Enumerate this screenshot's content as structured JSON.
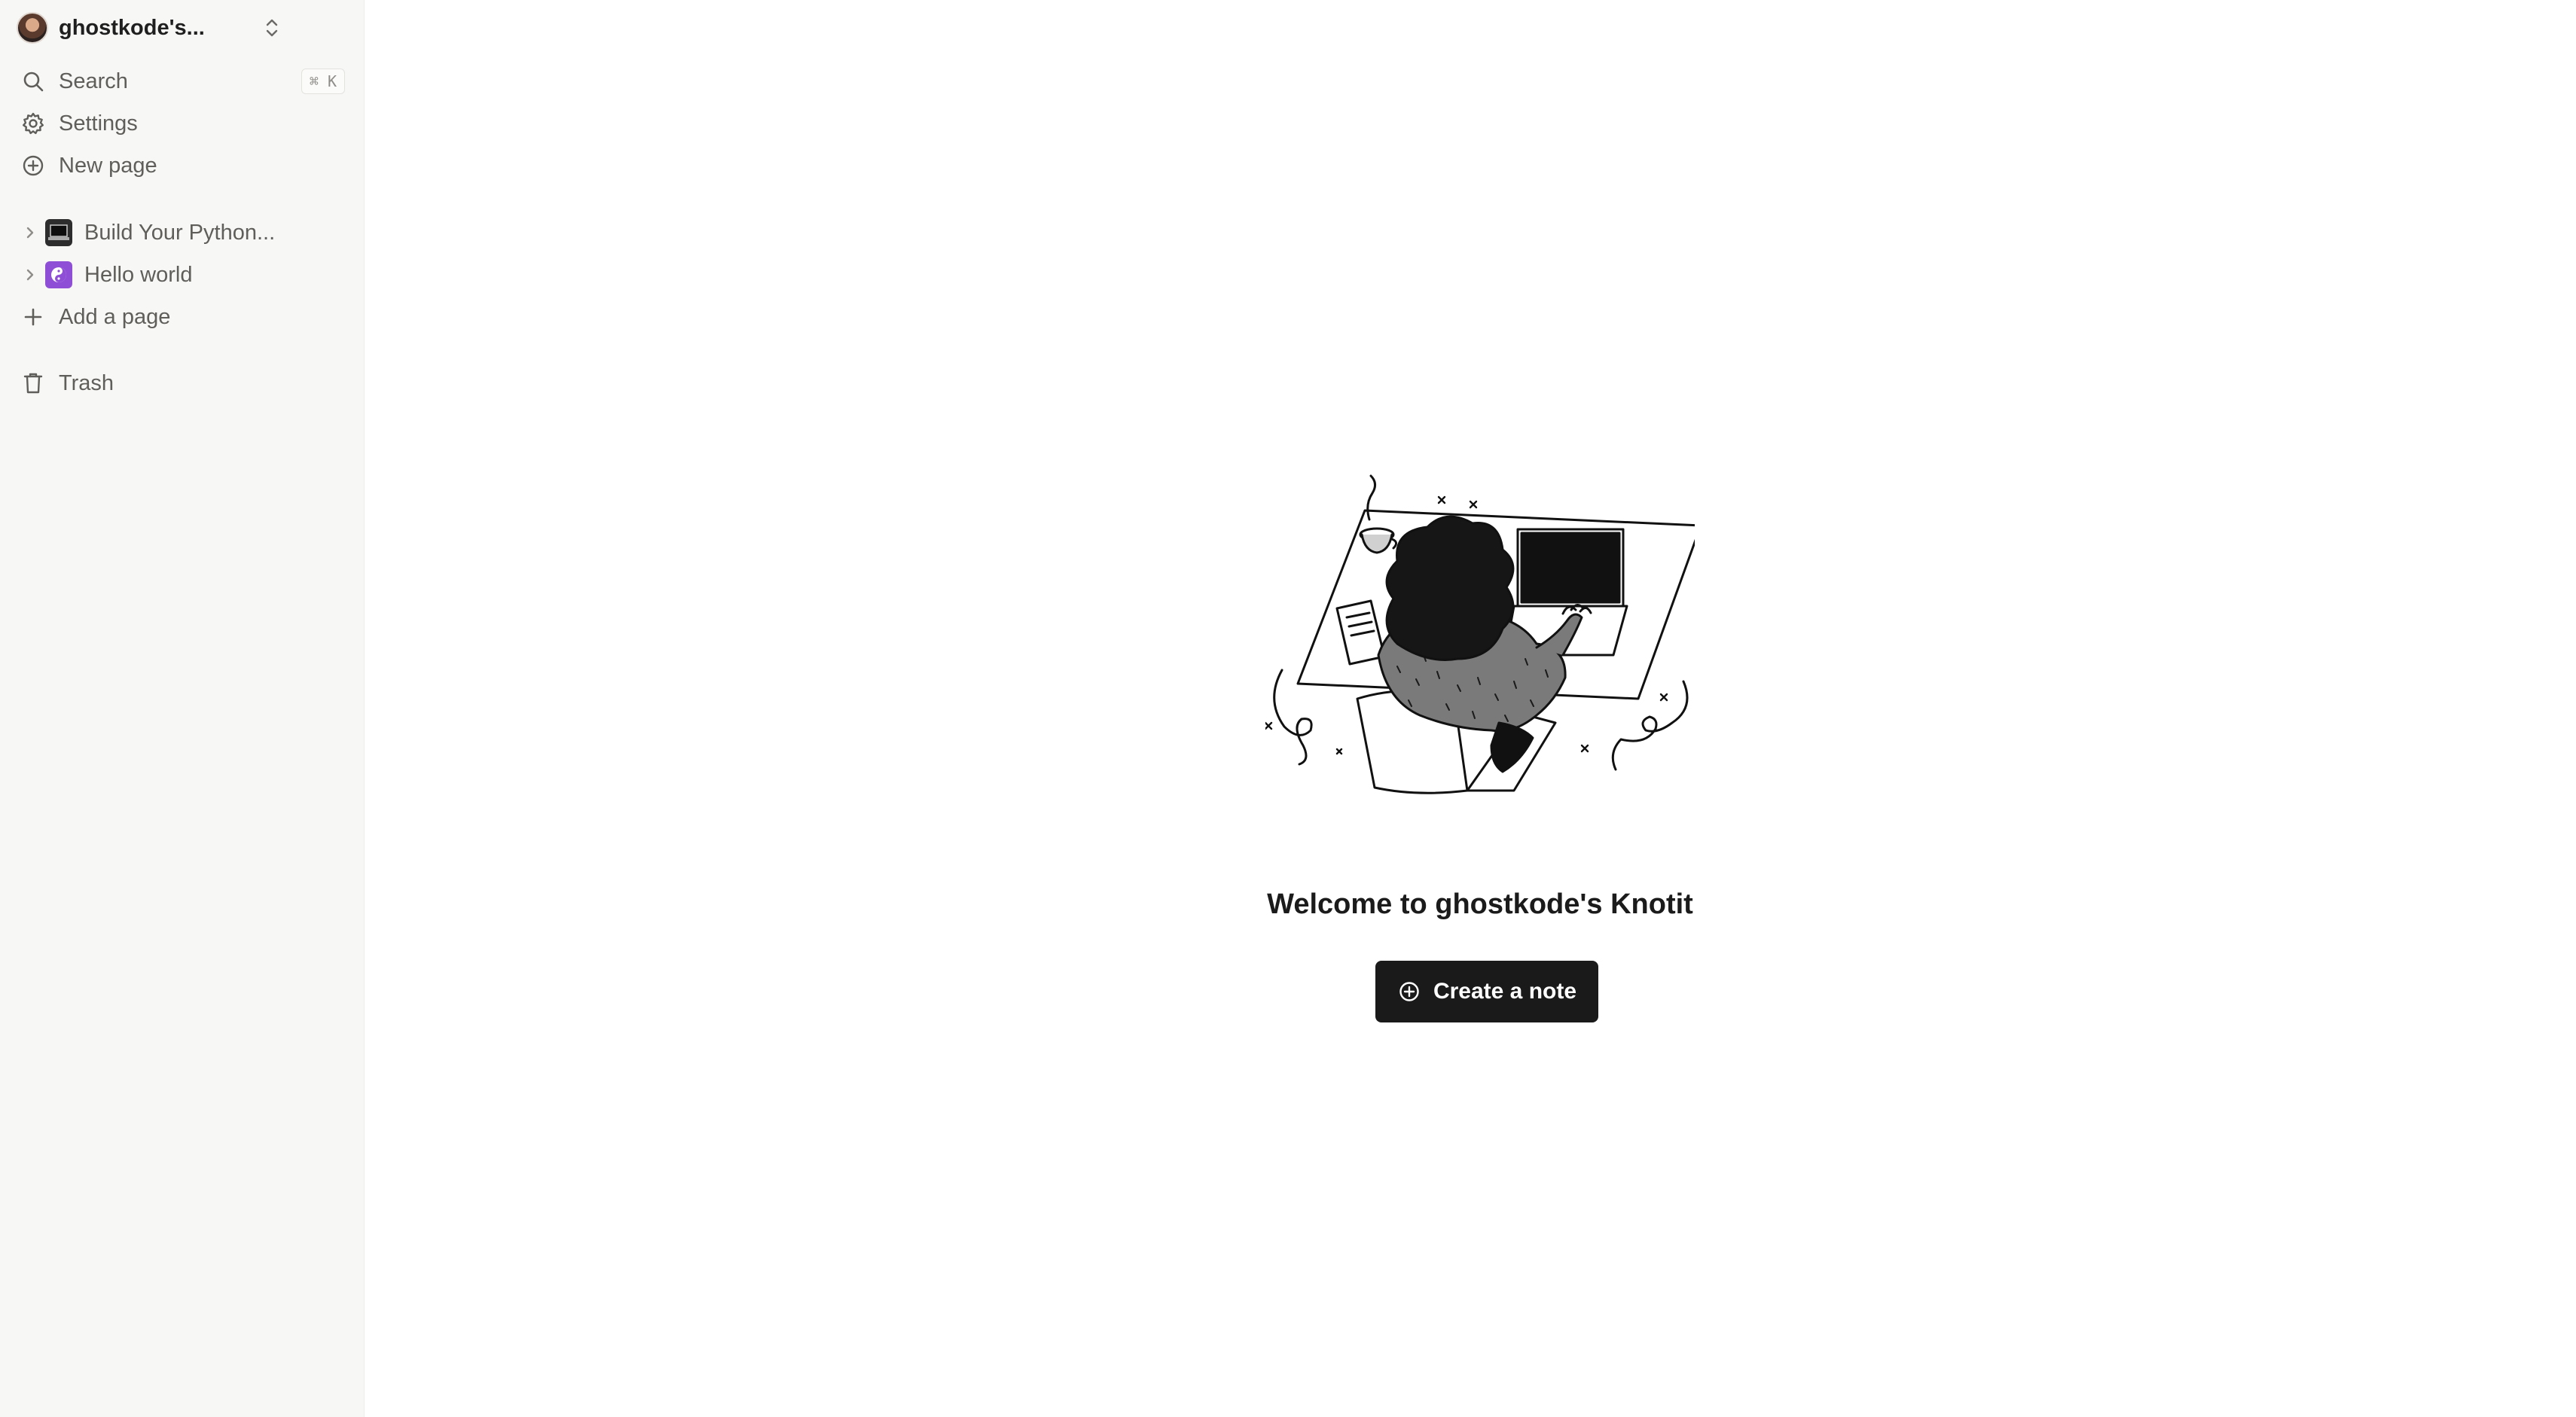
{
  "sidebar": {
    "workspace": {
      "name": "ghostkode's..."
    },
    "search": {
      "label": "Search",
      "shortcut": "⌘ K"
    },
    "settings_label": "Settings",
    "new_page_label": "New page",
    "pages": [
      {
        "title": "Build Your Python...",
        "icon": "laptop-icon"
      },
      {
        "title": "Hello world",
        "icon": "yin-yang-icon"
      }
    ],
    "add_page_label": "Add a page",
    "trash_label": "Trash"
  },
  "main": {
    "welcome_text": "Welcome to ghostkode's Knotit",
    "create_button_label": "Create a note"
  },
  "colors": {
    "sidebar_bg": "#f7f7f5",
    "button_bg": "#1a1a1a",
    "text": "#37352f",
    "hello_icon_bg": "#8e4fd6"
  }
}
